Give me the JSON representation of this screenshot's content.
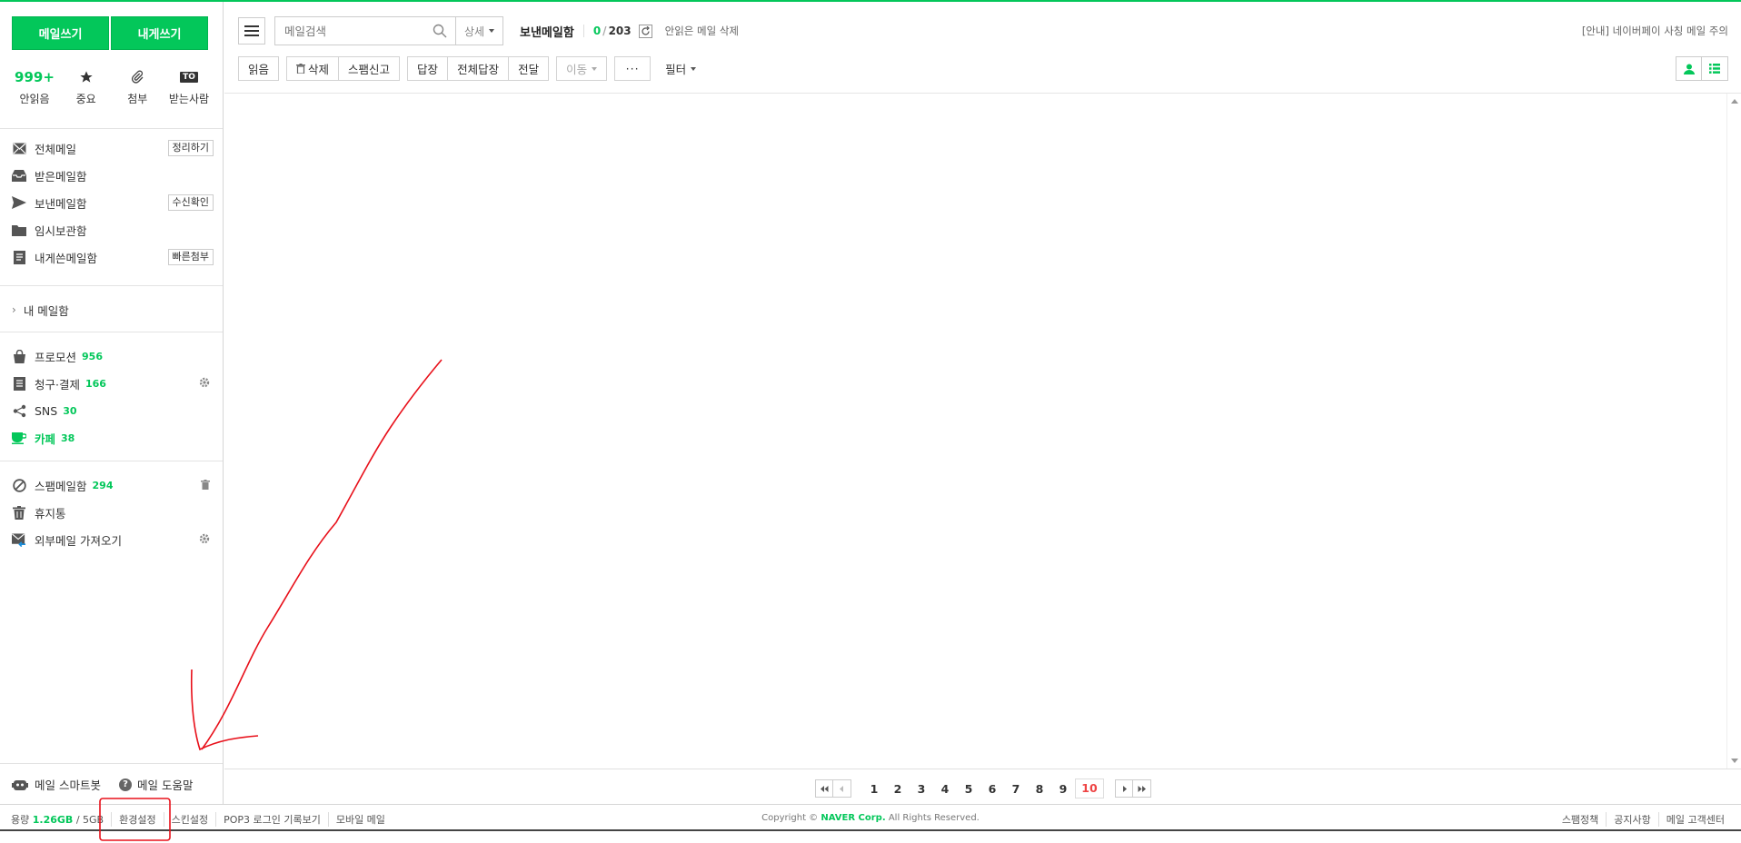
{
  "sidebar": {
    "write_mail": "메일쓰기",
    "write_self": "내게쓰기",
    "quick": {
      "unread_count": "999+",
      "unread_label": "안읽음",
      "important_label": "중요",
      "attach_label": "첨부",
      "to_icon_text": "TO",
      "recipient_label": "받는사람"
    },
    "folders": {
      "all": "전체메일",
      "all_btn": "정리하기",
      "inbox": "받은메일함",
      "sent": "보낸메일함",
      "sent_btn": "수신확인",
      "drafts": "임시보관함",
      "self": "내게쓴메일함",
      "self_btn": "빠른첨부"
    },
    "my_mailbox": "내 메일함",
    "categories": {
      "promo": "프로모션",
      "promo_count": "956",
      "billing": "청구·결제",
      "billing_count": "166",
      "sns": "SNS",
      "sns_count": "30",
      "cafe": "카페",
      "cafe_count": "38"
    },
    "others": {
      "spam": "스팸메일함",
      "spam_count": "294",
      "trash": "휴지통",
      "external": "외부메일 가져오기"
    },
    "bottom": {
      "smartbot": "메일 스마트봇",
      "help": "메일 도움말"
    }
  },
  "header": {
    "search_placeholder": "메일검색",
    "detail": "상세",
    "folder_title": "보낸메일함",
    "unread": "0",
    "total": "203",
    "delete_unread": "안읽은 메일 삭제",
    "notice": "[안내] 네이버페이 사칭 메일 주의"
  },
  "toolbar": {
    "read": "읽음",
    "delete": "삭제",
    "spam": "스팸신고",
    "reply": "답장",
    "reply_all": "전체답장",
    "forward": "전달",
    "move": "이동",
    "more": "···",
    "filter": "필터"
  },
  "pagination": {
    "pages": [
      "1",
      "2",
      "3",
      "4",
      "5",
      "6",
      "7",
      "8",
      "9"
    ],
    "current": "10"
  },
  "footer": {
    "storage_label": "용량",
    "storage_used": "1.26GB",
    "storage_total": "/ 5GB",
    "settings": "환경설정",
    "skin": "스킨설정",
    "pop3": "POP3 로그인 기록보기",
    "mobile": "모바일 메일",
    "copyright_pre": "Copyright ©",
    "copyright_corp": "NAVER Corp.",
    "copyright_post": "All Rights Reserved.",
    "spam_policy": "스팸정책",
    "announcements": "공지사항",
    "support": "메일 고객센터"
  },
  "colors": {
    "accent": "#03c75a",
    "annotation": "#e8101a"
  }
}
